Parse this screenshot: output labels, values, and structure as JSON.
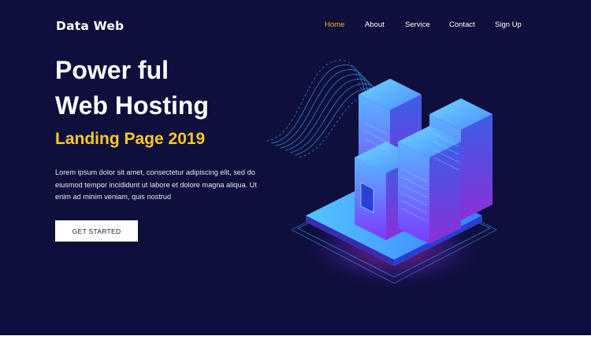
{
  "brand": {
    "logo_text": "Data Web"
  },
  "nav": {
    "items": [
      {
        "label": "Home",
        "active": true
      },
      {
        "label": "About",
        "active": false
      },
      {
        "label": "Service",
        "active": false
      },
      {
        "label": "Contact",
        "active": false
      },
      {
        "label": "Sign Up",
        "active": false
      }
    ]
  },
  "hero": {
    "title_line1": "Power ful",
    "title_line2": "Web Hosting",
    "subtitle": "Landing Page 2019",
    "description": "Lorem ipsum dolor sit amet, consectetur adipiscing elit, sed do eiusmod tempor incididunt ut labore et dolore magna aliqua. Ut enim ad minim veniam, quis nostrud",
    "cta_label": "GET STARTED"
  },
  "colors": {
    "background": "#0e0f3c",
    "accent_nav": "#f5b324",
    "subtitle": "#f9c82b"
  }
}
